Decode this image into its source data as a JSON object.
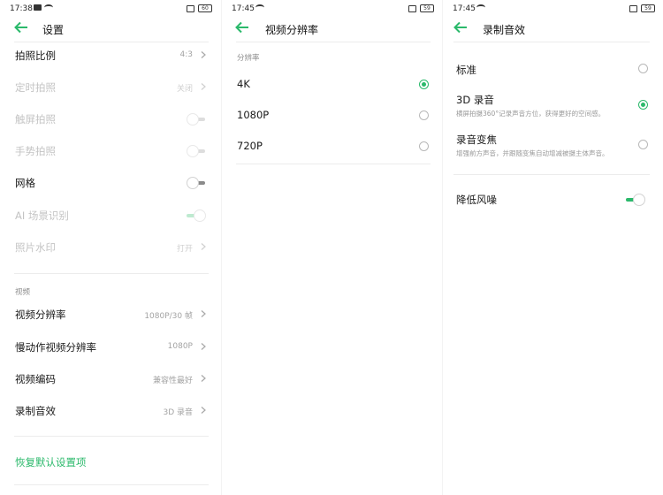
{
  "colors": {
    "accent": "#2bb96b",
    "text": "#1a1a1a",
    "disabled": "#c4c4c4",
    "secondary": "#a3a3a3"
  },
  "panel1": {
    "status": {
      "time": "17:38",
      "battery": "60"
    },
    "title": "设置",
    "rows": [
      {
        "label": "拍照比例",
        "value": "4:3",
        "control": "chevron",
        "enabled": true
      },
      {
        "label": "定时拍照",
        "value": "关闭",
        "control": "chevron",
        "enabled": false
      },
      {
        "label": "触屏拍照",
        "value": "",
        "control": "toggle",
        "toggle_on": false,
        "enabled": false
      },
      {
        "label": "手势拍照",
        "value": "",
        "control": "toggle",
        "toggle_on": false,
        "enabled": false
      },
      {
        "label": "网格",
        "value": "",
        "control": "toggle",
        "toggle_on": false,
        "enabled": true
      },
      {
        "label": "AI 场景识别",
        "value": "",
        "control": "toggle",
        "toggle_on": true,
        "enabled": false
      },
      {
        "label": "照片水印",
        "value": "打开",
        "control": "chevron",
        "enabled": false
      }
    ],
    "video_section_label": "视频",
    "video_rows": [
      {
        "label": "视频分辨率",
        "value": "1080P/30 帧"
      },
      {
        "label": "慢动作视频分辨率",
        "value": "1080P"
      },
      {
        "label": "视频编码",
        "value": "兼容性最好"
      },
      {
        "label": "录制音效",
        "value": "3D 录音"
      }
    ],
    "restore_label": "恢复默认设置项"
  },
  "panel2": {
    "status": {
      "time": "17:45",
      "battery": "59"
    },
    "title": "视频分辨率",
    "section_label": "分辨率",
    "options": [
      {
        "label": "4K",
        "selected": true
      },
      {
        "label": "1080P",
        "selected": false
      },
      {
        "label": "720P",
        "selected": false
      }
    ]
  },
  "panel3": {
    "status": {
      "time": "17:45",
      "battery": "59"
    },
    "title": "录制音效",
    "options": [
      {
        "label": "标准",
        "desc": "",
        "selected": false
      },
      {
        "label": "3D 录音",
        "desc": "横屏拍摄360°记录声音方位，获得更好的空间感。",
        "selected": true
      },
      {
        "label": "录音变焦",
        "desc": "增强前方声音，并跟随变焦自动增减被摄主体声音。",
        "selected": false
      }
    ],
    "noise_label": "降低风噪",
    "noise_on": true
  }
}
